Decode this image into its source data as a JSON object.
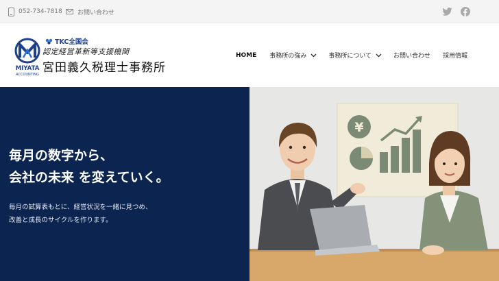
{
  "topbar": {
    "phone": "052-734-7818",
    "inquiry": "お問い合わせ",
    "social": [
      "twitter-icon",
      "facebook-icon"
    ]
  },
  "header": {
    "logo_text": "MIYATA",
    "logo_sub": "ACCOUNTING",
    "tkc_label": "TKC全国会",
    "certified_label": "認定経営革新等支援機関",
    "office_name": "宮田義久税理士事務所"
  },
  "nav": {
    "home": "HOME",
    "strengths": "事務所の強み",
    "about": "事務所について",
    "contact": "お問い合わせ",
    "recruit": "採用情報"
  },
  "hero": {
    "title_line1": "毎月の数字から、",
    "title_line2": "会社の未来 を変えていく。",
    "desc_line1": "毎月の試算表もとに、経営状況を一緒に見つめ、",
    "desc_line2": "改善と成長のサイクルを作ります。",
    "currency_symbol": "¥"
  },
  "colors": {
    "navy": "#0c2550",
    "accent_blue": "#2a6fd6",
    "topbar_bg": "#f4f4f4"
  }
}
